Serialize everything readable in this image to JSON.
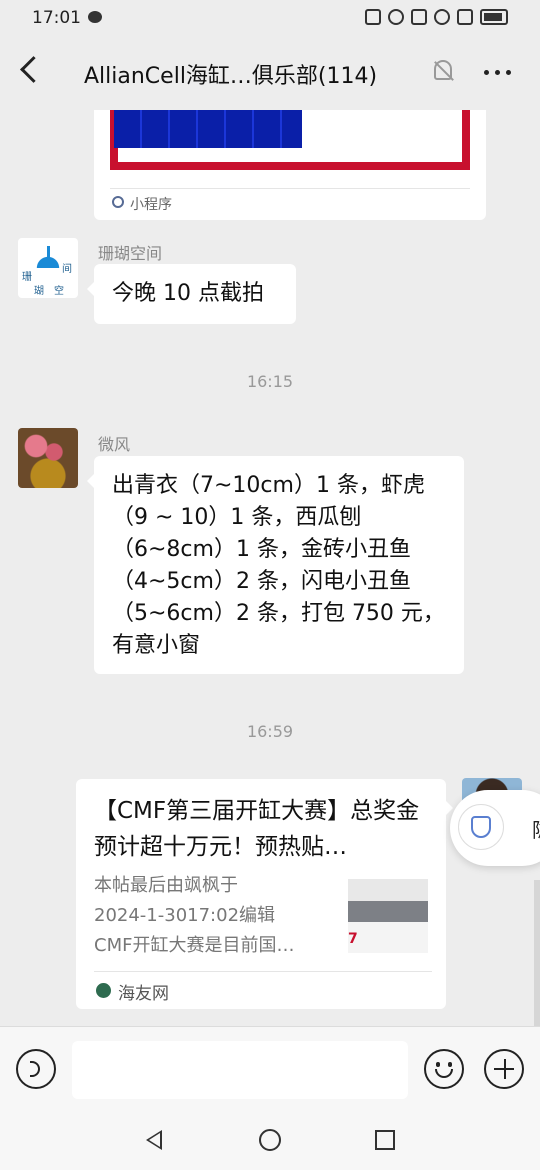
{
  "status_bar": {
    "time": "17:01"
  },
  "header": {
    "title": "AllianCell海缸…俱乐部(114)"
  },
  "messages": [
    {
      "type": "mini_program_card",
      "source_label": "小程序"
    },
    {
      "sender": "珊瑚空间",
      "avatar_text": [
        "珊",
        "瑚",
        "空",
        "间"
      ],
      "text": "今晚 10 点截拍"
    },
    {
      "type": "time",
      "text": "16:15"
    },
    {
      "sender": "微风",
      "lines": [
        "出青衣（7~10cm）1 条，虾虎",
        "（9 ~ 10）1 条，西瓜刨",
        "（6~8cm）1 条，金砖小丑鱼",
        "（4~5cm）2 条，闪电小丑鱼",
        "（5~6cm）2 条，打包 750 元，",
        "有意小窗"
      ]
    },
    {
      "type": "time",
      "text": "16:59"
    },
    {
      "type": "link_card",
      "title": "【CMF第三届开缸大赛】总奖金预计超十万元！预热贴…",
      "description_lines": [
        "本帖最后由飒枫于",
        "2024-1-3017:02编辑",
        "CMF开缸大赛是目前国…"
      ],
      "thumb_text": "7",
      "source": "海友网"
    }
  ],
  "floating_button": {
    "label": "隐"
  },
  "input": {
    "placeholder": ""
  }
}
